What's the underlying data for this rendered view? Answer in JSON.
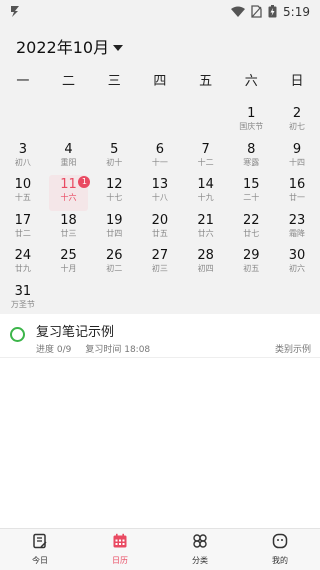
{
  "status": {
    "time": "5:19"
  },
  "header": {
    "month": "2022年10月"
  },
  "weekdays": [
    "一",
    "二",
    "三",
    "四",
    "五",
    "六",
    "日"
  ],
  "weeks": [
    [
      null,
      null,
      null,
      null,
      null,
      {
        "d": "1",
        "l": "国庆节"
      },
      {
        "d": "2",
        "l": "初七"
      }
    ],
    [
      {
        "d": "3",
        "l": "初八"
      },
      {
        "d": "4",
        "l": "重阳"
      },
      {
        "d": "5",
        "l": "初十"
      },
      {
        "d": "6",
        "l": "十一"
      },
      {
        "d": "7",
        "l": "十二"
      },
      {
        "d": "8",
        "l": "寒露"
      },
      {
        "d": "9",
        "l": "十四"
      }
    ],
    [
      {
        "d": "10",
        "l": "十五"
      },
      {
        "d": "11",
        "l": "十六",
        "today": true,
        "badge": "1"
      },
      {
        "d": "12",
        "l": "十七"
      },
      {
        "d": "13",
        "l": "十八"
      },
      {
        "d": "14",
        "l": "十九"
      },
      {
        "d": "15",
        "l": "二十"
      },
      {
        "d": "16",
        "l": "廿一"
      }
    ],
    [
      {
        "d": "17",
        "l": "廿二"
      },
      {
        "d": "18",
        "l": "廿三"
      },
      {
        "d": "19",
        "l": "廿四"
      },
      {
        "d": "20",
        "l": "廿五"
      },
      {
        "d": "21",
        "l": "廿六"
      },
      {
        "d": "22",
        "l": "廿七"
      },
      {
        "d": "23",
        "l": "霜降"
      }
    ],
    [
      {
        "d": "24",
        "l": "廿九"
      },
      {
        "d": "25",
        "l": "十月"
      },
      {
        "d": "26",
        "l": "初二"
      },
      {
        "d": "27",
        "l": "初三"
      },
      {
        "d": "28",
        "l": "初四"
      },
      {
        "d": "29",
        "l": "初五"
      },
      {
        "d": "30",
        "l": "初六"
      }
    ],
    [
      {
        "d": "31",
        "l": "万圣节"
      },
      null,
      null,
      null,
      null,
      null,
      null
    ]
  ],
  "task": {
    "title": "复习笔记示例",
    "progress": "进度 0/9",
    "review_time": "复习时间 18:08",
    "category": "类别示例"
  },
  "nav": [
    {
      "label": "今日",
      "icon": "today-doc-icon"
    },
    {
      "label": "日历",
      "icon": "calendar-icon",
      "active": true
    },
    {
      "label": "分类",
      "icon": "category-icon"
    },
    {
      "label": "我的",
      "icon": "profile-icon"
    }
  ],
  "colors": {
    "accent": "#e94a62",
    "task_circle": "#3cb54a"
  }
}
